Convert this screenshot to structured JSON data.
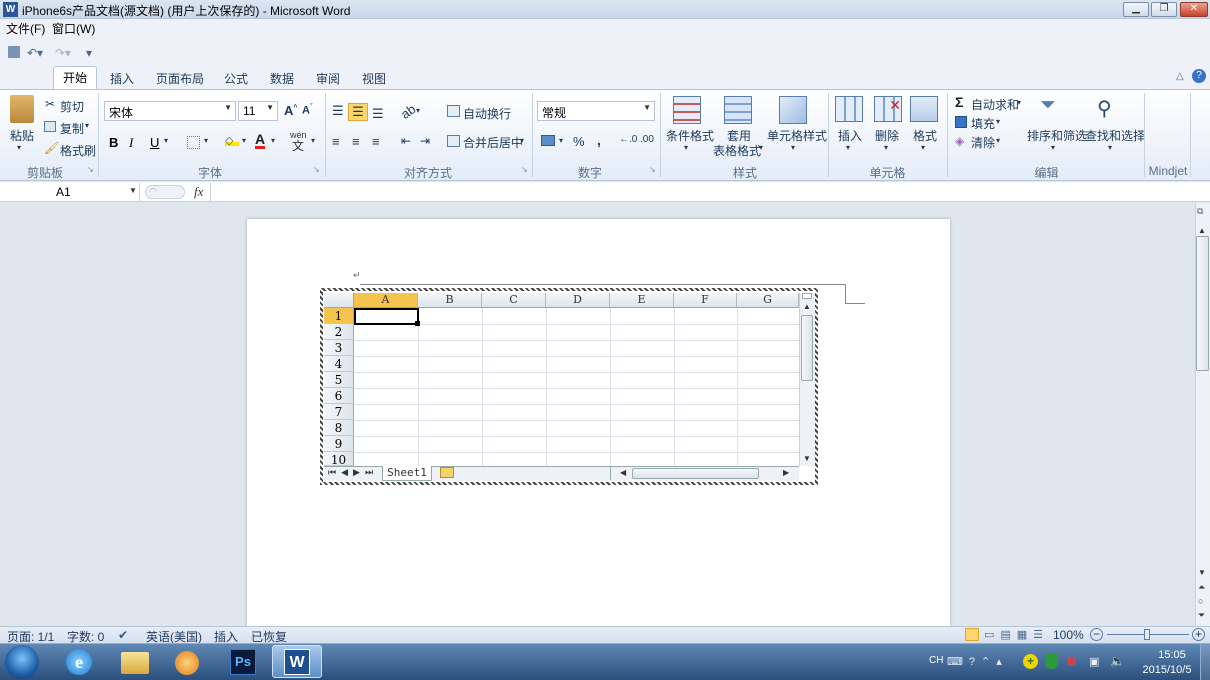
{
  "window": {
    "title": "iPhone6s产品文档(源文档) (用户上次保存的) - Microsoft Word",
    "app_icon": "W"
  },
  "menu": [
    "文件(F)",
    "窗口(W)"
  ],
  "tabs": [
    "开始",
    "插入",
    "页面布局",
    "公式",
    "数据",
    "审阅",
    "视图"
  ],
  "clipboard": {
    "paste": "粘贴",
    "cut": "剪切",
    "copy": "复制",
    "format_painter": "格式刷",
    "label": "剪贴板"
  },
  "font": {
    "name": "宋体",
    "size": "11",
    "bold": "B",
    "italic": "I",
    "underline": "U",
    "label": "字体",
    "wen": "wén",
    "font_color_letter": "A"
  },
  "alignment": {
    "wrap": "自动换行",
    "merge": "合并后居中",
    "label": "对齐方式"
  },
  "number": {
    "format": "常规",
    "percent": "%",
    "comma": ",",
    "label": "数字"
  },
  "styles": {
    "conditional": "条件格式",
    "table_format_1": "套用",
    "table_format_2": "表格格式",
    "cell_styles": "单元格样式",
    "label": "样式"
  },
  "cells": {
    "insert": "插入",
    "delete": "删除",
    "format": "格式",
    "label": "单元格"
  },
  "editing": {
    "autosum": "自动求和",
    "fill": "填充",
    "clear": "清除",
    "sort_filter": "排序和筛选",
    "find_select": "查找和选择",
    "label": "编辑",
    "sigma": "Σ"
  },
  "mindjet": {
    "label": "Mindjet"
  },
  "formula": {
    "name_box": "A1",
    "fx": "fx",
    "value": ""
  },
  "paragraph_mark": "↵",
  "spreadsheet": {
    "columns": [
      "A",
      "B",
      "C",
      "D",
      "E",
      "F",
      "G"
    ],
    "rows": [
      "1",
      "2",
      "3",
      "4",
      "5",
      "6",
      "7",
      "8",
      "9",
      "10"
    ],
    "selected_cell": "A1",
    "sheet_tab": "Sheet1"
  },
  "status": {
    "page": "页面: 1/1",
    "words": "字数: 0",
    "language": "英语(美国)",
    "insert": "插入",
    "recovered": "已恢复",
    "zoom": "100%"
  },
  "taskbar": {
    "lang": "CH",
    "time": "15:05",
    "date": "2015/10/5"
  },
  "colors": {
    "ribbon_text": "#1e395b",
    "selection": "#f5c44e",
    "word_blue": "#2b579a"
  }
}
